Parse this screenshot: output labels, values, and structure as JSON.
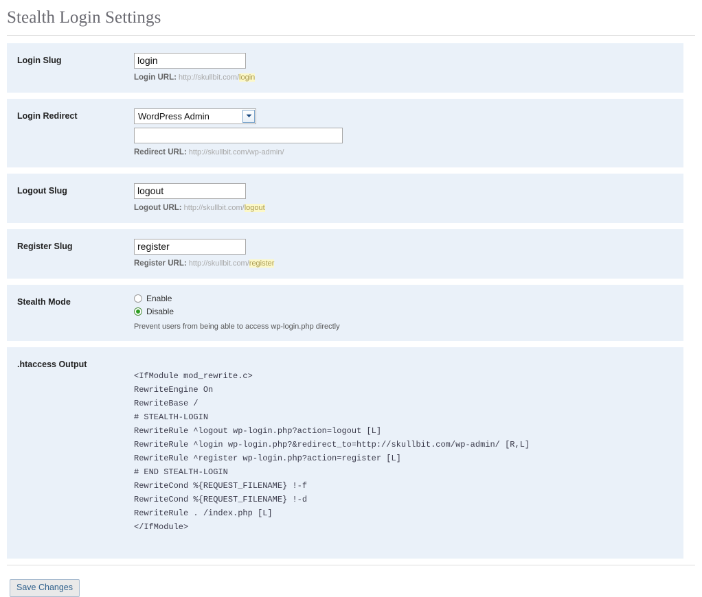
{
  "page": {
    "title": "Stealth Login Settings"
  },
  "rows": {
    "login_slug": {
      "label": "Login Slug",
      "input_value": "login",
      "input_placeholder": "",
      "help_label": "Login URL:",
      "help_url": " http://skullbit.com/",
      "help_slug": "login"
    },
    "login_redirect": {
      "label": "Login Redirect",
      "select_value": "WordPress Admin",
      "select_options": [
        "WordPress Admin"
      ],
      "custom_value": "",
      "custom_placeholder": "",
      "help_label": "Redirect URL:",
      "help_url": " http://skullbit.com/wp-admin/"
    },
    "logout_slug": {
      "label": "Logout Slug",
      "input_value": "logout",
      "input_placeholder": "",
      "help_label": "Logout URL:",
      "help_url": " http://skullbit.com/",
      "help_slug": "logout"
    },
    "register_slug": {
      "label": "Register Slug",
      "input_value": "register",
      "input_placeholder": "",
      "help_label": "Register URL:",
      "help_url": " http://skullbit.com/",
      "help_slug": "register"
    },
    "stealth_mode": {
      "label": "Stealth Mode",
      "enable_label": "Enable",
      "disable_label": "Disable",
      "selected": "Disable",
      "note": "Prevent users from being able to access wp-login.php directly"
    },
    "htaccess": {
      "label": ".htaccess Output",
      "code": "<IfModule mod_rewrite.c>\nRewriteEngine On\nRewriteBase /\n# STEALTH-LOGIN\nRewriteRule ^logout wp-login.php?action=logout [L]\nRewriteRule ^login wp-login.php?&redirect_to=http://skullbit.com/wp-admin/ [R,L]\nRewriteRule ^register wp-login.php?action=register [L]\n# END STEALTH-LOGIN\nRewriteCond %{REQUEST_FILENAME} !-f\nRewriteCond %{REQUEST_FILENAME} !-d\nRewriteRule . /index.php [L]\n</IfModule>"
    }
  },
  "footer": {
    "save_label": "Save Changes"
  },
  "colors": {
    "row_background": "#eaf1f9",
    "highlight": "#fcf8c8",
    "radio_selected": "#2e9e23",
    "button_text": "#2d5f8b",
    "title_text": "#6b6b72"
  }
}
